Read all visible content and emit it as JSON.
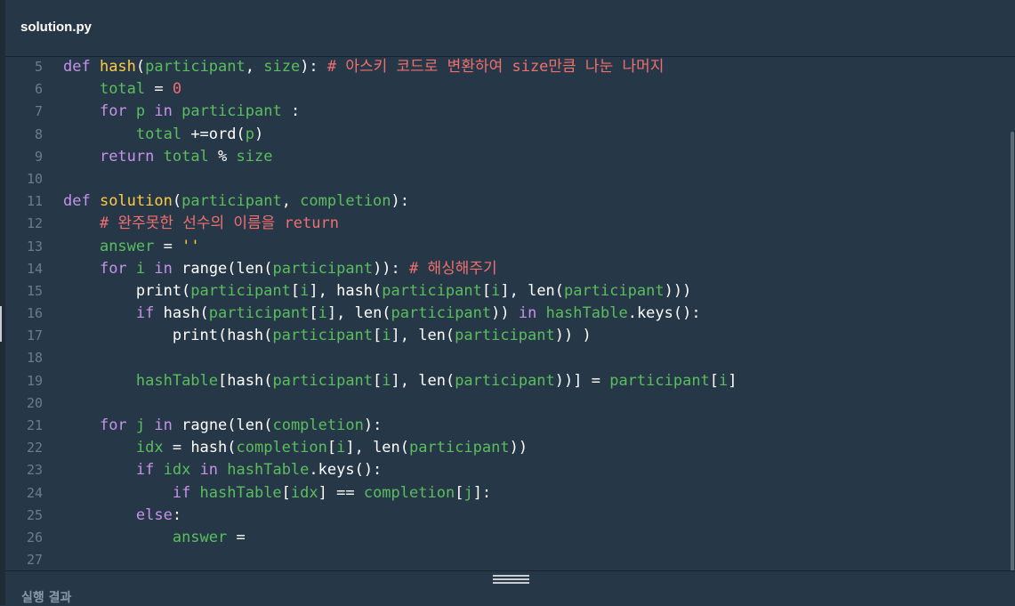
{
  "tab": {
    "filename": "solution.py"
  },
  "editor": {
    "lines": [
      {
        "n": "5",
        "tokens": [
          [
            "kw",
            "def "
          ],
          [
            "fn",
            "hash"
          ],
          [
            "op",
            "("
          ],
          [
            "var",
            "participant"
          ],
          [
            "op",
            ", "
          ],
          [
            "var",
            "size"
          ],
          [
            "op",
            "): "
          ],
          [
            "cm",
            "# 아스키 코드로 변환하여 size만큼 나눈 나머지"
          ]
        ]
      },
      {
        "n": "6",
        "tokens": [
          [
            "op",
            "    "
          ],
          [
            "var",
            "total"
          ],
          [
            "op",
            " = "
          ],
          [
            "num",
            "0"
          ]
        ]
      },
      {
        "n": "7",
        "tokens": [
          [
            "op",
            "    "
          ],
          [
            "kw",
            "for "
          ],
          [
            "var",
            "p"
          ],
          [
            "kw",
            " in "
          ],
          [
            "var",
            "participant"
          ],
          [
            "op",
            " :"
          ]
        ]
      },
      {
        "n": "8",
        "tokens": [
          [
            "op",
            "        "
          ],
          [
            "var",
            "total"
          ],
          [
            "op",
            " +=ord("
          ],
          [
            "var",
            "p"
          ],
          [
            "op",
            ")"
          ]
        ]
      },
      {
        "n": "9",
        "tokens": [
          [
            "op",
            "    "
          ],
          [
            "kw",
            "return "
          ],
          [
            "var",
            "total"
          ],
          [
            "op",
            " % "
          ],
          [
            "var",
            "size"
          ]
        ]
      },
      {
        "n": "10",
        "tokens": []
      },
      {
        "n": "11",
        "tokens": [
          [
            "kw",
            "def "
          ],
          [
            "fn",
            "solution"
          ],
          [
            "op",
            "("
          ],
          [
            "var",
            "participant"
          ],
          [
            "op",
            ", "
          ],
          [
            "var",
            "completion"
          ],
          [
            "op",
            "):"
          ]
        ]
      },
      {
        "n": "12",
        "tokens": [
          [
            "op",
            "    "
          ],
          [
            "cm",
            "# 완주못한 선수의 이름을 return"
          ]
        ]
      },
      {
        "n": "13",
        "tokens": [
          [
            "op",
            "    "
          ],
          [
            "var",
            "answer"
          ],
          [
            "op",
            " = "
          ],
          [
            "str",
            "''"
          ]
        ]
      },
      {
        "n": "14",
        "tokens": [
          [
            "op",
            "    "
          ],
          [
            "kw",
            "for "
          ],
          [
            "var",
            "i"
          ],
          [
            "kw",
            " in "
          ],
          [
            "op",
            "range(len("
          ],
          [
            "var",
            "participant"
          ],
          [
            "op",
            ")): "
          ],
          [
            "cm",
            "# 해싱해주기"
          ]
        ]
      },
      {
        "n": "15",
        "tokens": [
          [
            "op",
            "        print("
          ],
          [
            "var",
            "participant"
          ],
          [
            "op",
            "["
          ],
          [
            "var",
            "i"
          ],
          [
            "op",
            "], hash("
          ],
          [
            "var",
            "participant"
          ],
          [
            "op",
            "["
          ],
          [
            "var",
            "i"
          ],
          [
            "op",
            "], len("
          ],
          [
            "var",
            "participant"
          ],
          [
            "op",
            ")))"
          ]
        ]
      },
      {
        "n": "16",
        "tokens": [
          [
            "op",
            "        "
          ],
          [
            "kw",
            "if "
          ],
          [
            "op",
            "hash("
          ],
          [
            "var",
            "participant"
          ],
          [
            "op",
            "["
          ],
          [
            "var",
            "i"
          ],
          [
            "op",
            "], len("
          ],
          [
            "var",
            "participant"
          ],
          [
            "op",
            ")) "
          ],
          [
            "kw",
            "in "
          ],
          [
            "var",
            "hashTable"
          ],
          [
            "op",
            ".keys():"
          ]
        ]
      },
      {
        "n": "17",
        "tokens": [
          [
            "op",
            "            print(hash("
          ],
          [
            "var",
            "participant"
          ],
          [
            "op",
            "["
          ],
          [
            "var",
            "i"
          ],
          [
            "op",
            "], len("
          ],
          [
            "var",
            "participant"
          ],
          [
            "op",
            ")) )"
          ]
        ]
      },
      {
        "n": "18",
        "tokens": []
      },
      {
        "n": "19",
        "tokens": [
          [
            "op",
            "        "
          ],
          [
            "var",
            "hashTable"
          ],
          [
            "op",
            "[hash("
          ],
          [
            "var",
            "participant"
          ],
          [
            "op",
            "["
          ],
          [
            "var",
            "i"
          ],
          [
            "op",
            "], len("
          ],
          [
            "var",
            "participant"
          ],
          [
            "op",
            "))] = "
          ],
          [
            "var",
            "participant"
          ],
          [
            "op",
            "["
          ],
          [
            "var",
            "i"
          ],
          [
            "op",
            "]"
          ]
        ]
      },
      {
        "n": "20",
        "tokens": []
      },
      {
        "n": "21",
        "tokens": [
          [
            "op",
            "    "
          ],
          [
            "kw",
            "for "
          ],
          [
            "var",
            "j"
          ],
          [
            "kw",
            " in "
          ],
          [
            "op",
            "ragne(len("
          ],
          [
            "var",
            "completion"
          ],
          [
            "op",
            "):"
          ]
        ]
      },
      {
        "n": "22",
        "tokens": [
          [
            "op",
            "        "
          ],
          [
            "var",
            "idx"
          ],
          [
            "op",
            " = hash("
          ],
          [
            "var",
            "completion"
          ],
          [
            "op",
            "["
          ],
          [
            "var",
            "i"
          ],
          [
            "op",
            "], len("
          ],
          [
            "var",
            "participant"
          ],
          [
            "op",
            "))"
          ]
        ]
      },
      {
        "n": "23",
        "tokens": [
          [
            "op",
            "        "
          ],
          [
            "kw",
            "if "
          ],
          [
            "var",
            "idx"
          ],
          [
            "kw",
            " in "
          ],
          [
            "var",
            "hashTable"
          ],
          [
            "op",
            ".keys():"
          ]
        ]
      },
      {
        "n": "24",
        "tokens": [
          [
            "op",
            "            "
          ],
          [
            "kw",
            "if "
          ],
          [
            "var",
            "hashTable"
          ],
          [
            "op",
            "["
          ],
          [
            "var",
            "idx"
          ],
          [
            "op",
            "] == "
          ],
          [
            "var",
            "completion"
          ],
          [
            "op",
            "["
          ],
          [
            "var",
            "j"
          ],
          [
            "op",
            "]:"
          ]
        ]
      },
      {
        "n": "25",
        "tokens": [
          [
            "op",
            "        "
          ],
          [
            "kw",
            "else"
          ],
          [
            "op",
            ":"
          ]
        ]
      },
      {
        "n": "26",
        "tokens": [
          [
            "op",
            "            "
          ],
          [
            "var",
            "answer"
          ],
          [
            "op",
            " ="
          ]
        ]
      },
      {
        "n": "27",
        "tokens": []
      }
    ]
  },
  "footer": {
    "result_label": "실행 결과"
  },
  "colors": {
    "background": "#263747",
    "keyword": "#c792ea",
    "function": "#ffcb45",
    "variable": "#5bbe5e",
    "number": "#f07070",
    "comment": "#f07070"
  }
}
